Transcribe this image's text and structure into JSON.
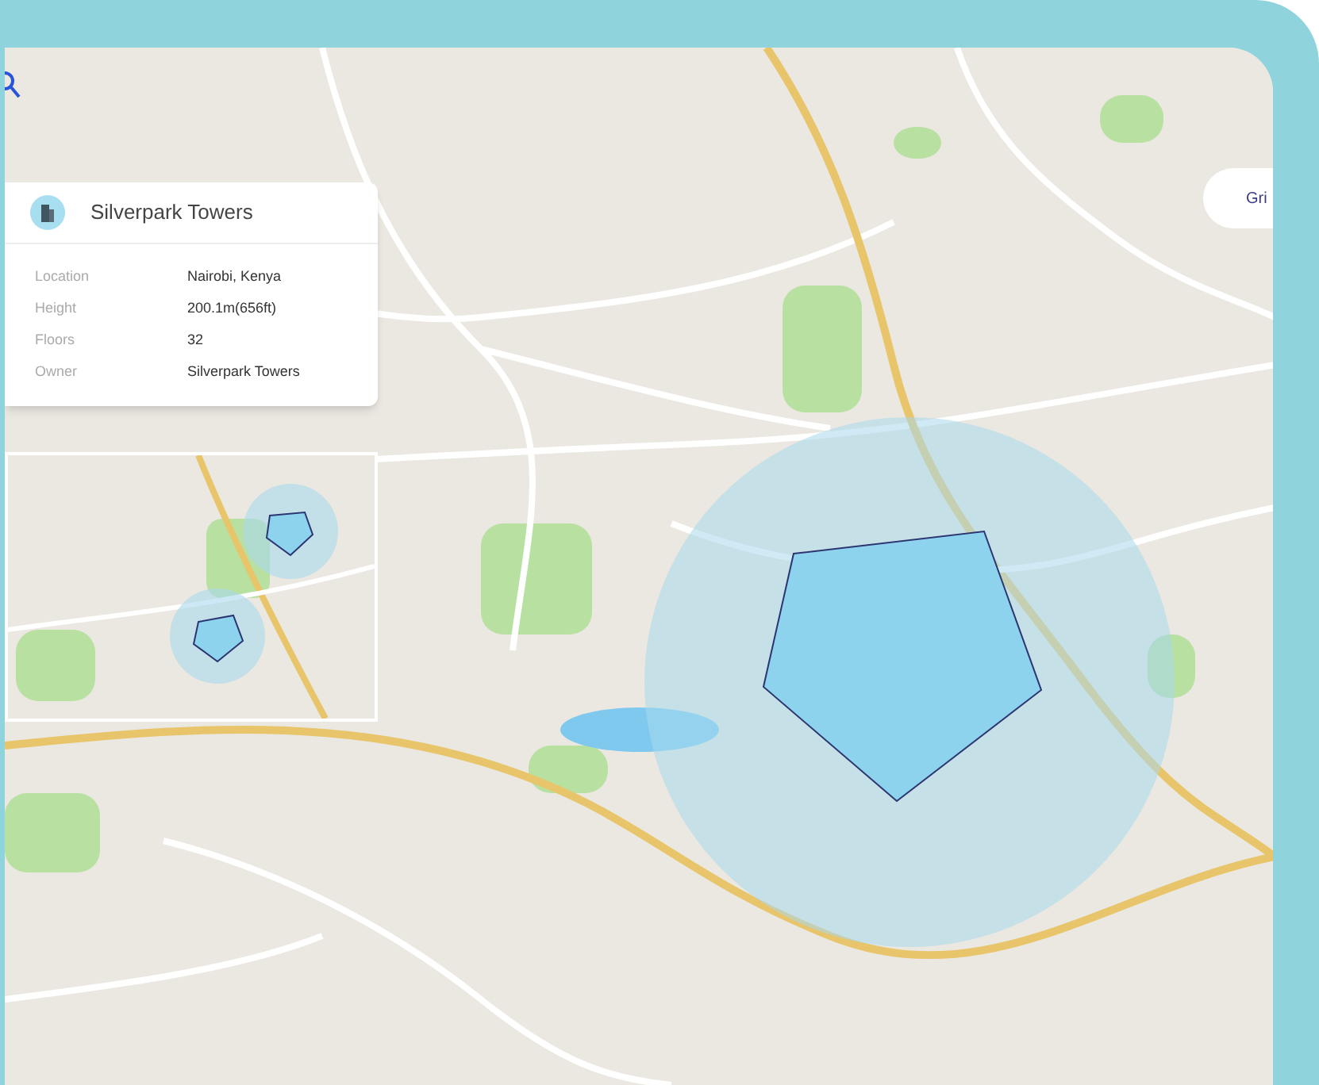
{
  "building_card": {
    "title": "Silverpark Towers",
    "fields": [
      {
        "label": "Location",
        "value": "Nairobi, Kenya"
      },
      {
        "label": "Height",
        "value": "200.1m(656ft)"
      },
      {
        "label": "Floors",
        "value": "32"
      },
      {
        "label": "Owner",
        "value": "Silverpark Towers"
      }
    ]
  },
  "map_button": {
    "label": "Gri"
  }
}
